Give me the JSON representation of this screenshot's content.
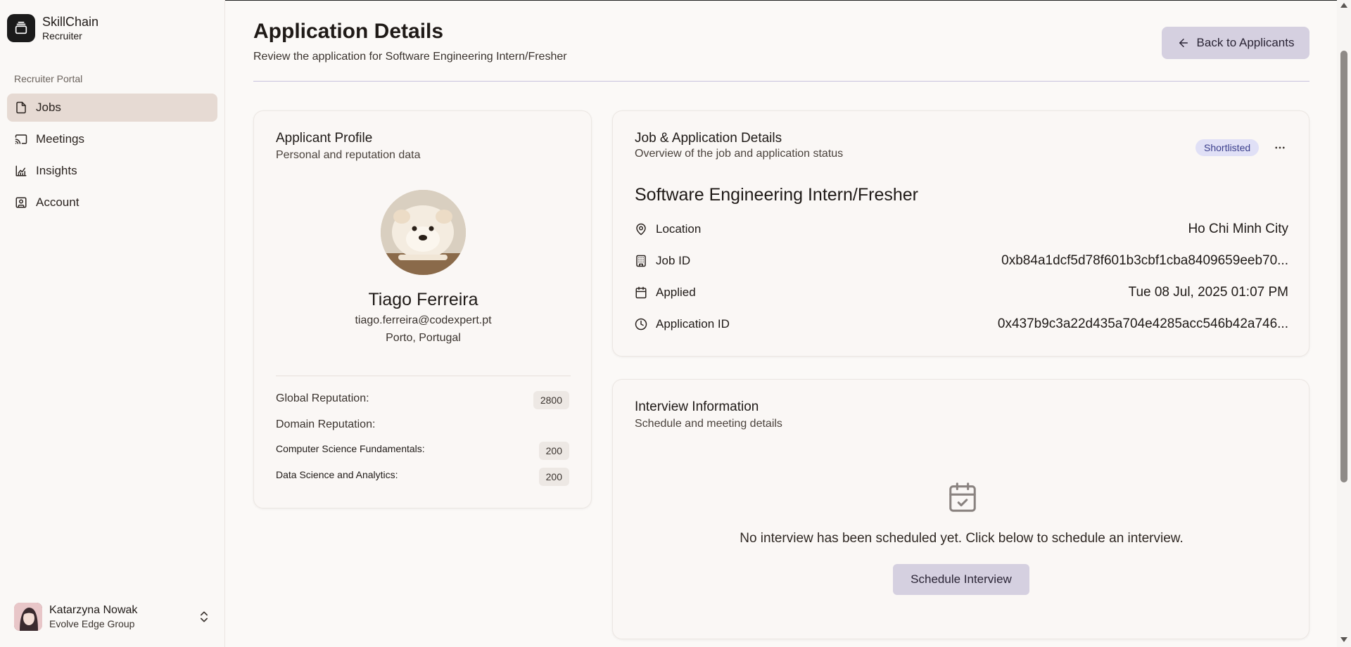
{
  "brand": {
    "name": "SkillChain",
    "sub": "Recruiter",
    "icon": "stack-icon"
  },
  "sidebar": {
    "section_label": "Recruiter Portal",
    "items": [
      {
        "label": "Jobs",
        "icon": "file-icon",
        "active": true
      },
      {
        "label": "Meetings",
        "icon": "cast-icon",
        "active": false
      },
      {
        "label": "Insights",
        "icon": "chart-icon",
        "active": false
      },
      {
        "label": "Account",
        "icon": "user-square-icon",
        "active": false
      }
    ],
    "user": {
      "name": "Katarzyna Nowak",
      "org": "Evolve Edge Group"
    }
  },
  "header": {
    "title": "Application Details",
    "subtitle": "Review the application for Software Engineering Intern/Fresher",
    "back_label": "Back to Applicants"
  },
  "profile": {
    "title": "Applicant Profile",
    "desc": "Personal and reputation data",
    "name": "Tiago Ferreira",
    "email": "tiago.ferreira@codexpert.pt",
    "location": "Porto, Portugal",
    "global_label": "Global Reputation:",
    "global_value": "2800",
    "domain_label": "Domain Reputation:",
    "domains": [
      {
        "label": "Computer Science Fundamentals:",
        "value": "200"
      },
      {
        "label": "Data Science and Analytics:",
        "value": "200"
      }
    ]
  },
  "job": {
    "title": "Job & Application Details",
    "desc": "Overview of the job and application status",
    "status": "Shortlisted",
    "job_title": "Software Engineering Intern/Fresher",
    "rows": [
      {
        "label": "Location",
        "value": "Ho Chi Minh City",
        "icon": "map-pin-icon"
      },
      {
        "label": "Job ID",
        "value": "0xb84a1dcf5d78f601b3cbf1cba8409659eeb70...",
        "icon": "building-icon"
      },
      {
        "label": "Applied",
        "value": "Tue 08 Jul, 2025 01:07 PM",
        "icon": "calendar-icon"
      },
      {
        "label": "Application ID",
        "value": "0x437b9c3a22d435a704e4285acc546b42a746...",
        "icon": "clock-icon"
      }
    ]
  },
  "interview": {
    "title": "Interview Information",
    "desc": "Schedule and meeting details",
    "empty_text": "No interview has been scheduled yet. Click below to schedule an interview.",
    "button": "Schedule Interview"
  },
  "colors": {
    "active_nav": "#e6dad3",
    "button_bg": "#d5d0e0",
    "badge_bg": "#e0e0f6",
    "badge_text": "#3b3f8c"
  }
}
